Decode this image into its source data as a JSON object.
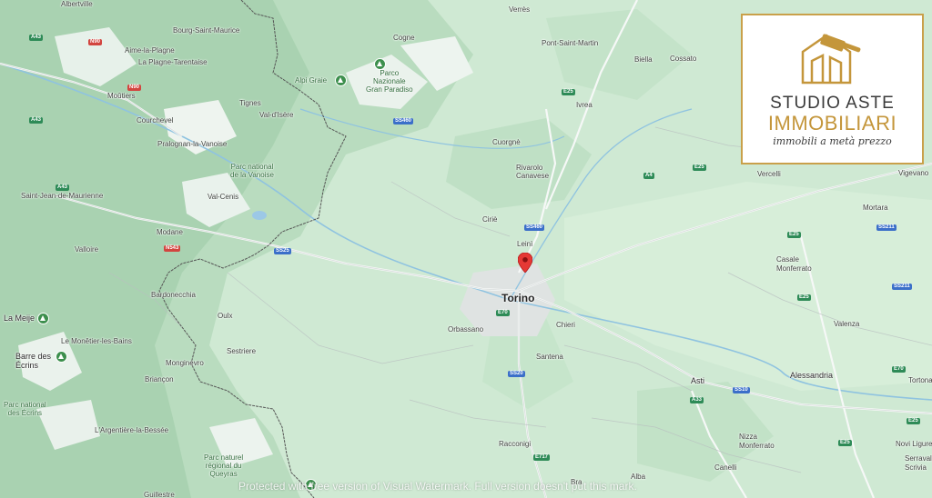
{
  "map": {
    "pin_color": "#e53935",
    "labels": {
      "albertville": "Albertville",
      "bourg": "Bourg-Saint-Maurice",
      "aime": "Aime-la-Plagne",
      "plagne": "La Plagne-Tarentaise",
      "moutiers": "Moûtiers",
      "courchevel": "Courchevel",
      "pralognan": "Pralognan-la-Vanoise",
      "tignes": "Tignes",
      "valdisere": "Val-d'Isère",
      "vanoise": "Parc national\nde la Vanoise",
      "valcenis": "Val-Cenis",
      "stjean": "Saint-Jean-de-Maurienne",
      "modane": "Modane",
      "valloire": "Valloire",
      "bardonecchia": "Bardonecchia",
      "oulx": "Oulx",
      "sestriere": "Sestriere",
      "meije": "La Meije",
      "monetier": "Le Monêtier-les-Bains",
      "barre": "Barre des\nÉcrins",
      "ecrins": "Parc national\ndes Écrins",
      "briancon": "Briançon",
      "monginevro": "Monginevro",
      "argentiere": "L'Argentière-la-Bessée",
      "queyras": "Parc naturel\nrégional du\nQueyras",
      "guillestre": "Guillestre",
      "alpigraie": "Alpi Graie",
      "cogne": "Cogne",
      "paradiso": "Parco\nNazionale\nGran Paradiso",
      "verres": "Verrès",
      "pontstmartin": "Pont-Saint-Martin",
      "biella": "Biella",
      "cossato": "Cossato",
      "ivrea": "Ivrea",
      "cuorgne": "Cuorgnè",
      "rivarolo": "Rivarolo\nCanavese",
      "cirie": "Ciriè",
      "leini": "Leinì",
      "torino": "Torino",
      "orbassano": "Orbassano",
      "chieri": "Chieri",
      "santena": "Santena",
      "vercelli": "Vercelli",
      "vigevano": "Vigevano",
      "mortara": "Mortara",
      "casale": "Casale\nMonferrato",
      "valenza": "Valenza",
      "alessandria": "Alessandria",
      "asti": "Asti",
      "tortona": "Tortona",
      "nizza": "Nizza\nMonferrato",
      "canelli": "Canelli",
      "novi": "Novi Ligure",
      "serravalle": "Serravalle\nScrivia",
      "racconigi": "Racconigi",
      "bra": "Bra",
      "alba": "Alba"
    },
    "shields": {
      "a43a": "A43",
      "a43b": "A43",
      "a43c": "A43",
      "n90": "N90",
      "n90b": "N90",
      "n543": "N543",
      "ss460a": "SS460",
      "ss460b": "SS460",
      "ss25": "SS25",
      "e25a": "E25",
      "e25b": "E25",
      "a4": "A4",
      "e25c": "E25",
      "e70": "E70",
      "ss20": "SS20",
      "e717": "E717",
      "a33": "A33",
      "ss10": "SS10",
      "ss211a": "SS211",
      "ss211b": "SS211",
      "e25d": "E25",
      "e70b": "E70",
      "e25e": "E25",
      "e25f": "E25",
      "a26": "A26"
    }
  },
  "logo": {
    "line1": "STUDIO ASTE",
    "line2": "IMMOBILIARI",
    "line3": "immobili a metà prezzo",
    "brand_gold": "#c4963b"
  },
  "watermark": "Protected with free version of Visual Watermark. Full version doesn't put this mark."
}
